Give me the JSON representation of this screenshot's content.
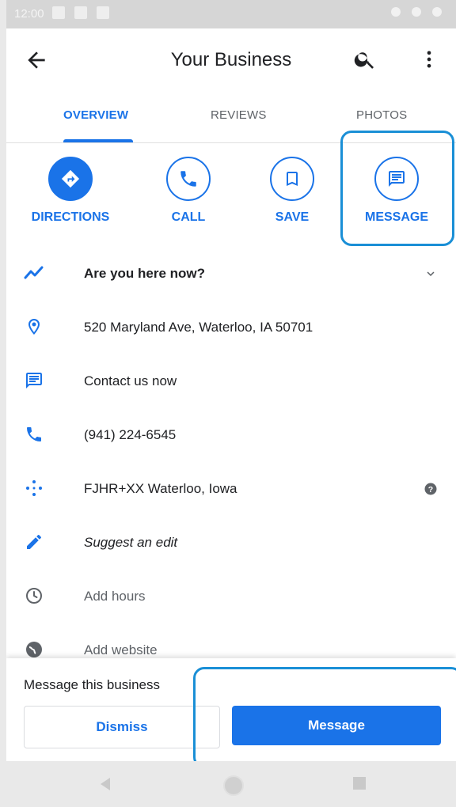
{
  "status_bar": {
    "time": "12:00"
  },
  "app_bar": {
    "title": "Your Business"
  },
  "tabs": [
    {
      "label": "OVERVIEW",
      "active": true
    },
    {
      "label": "REVIEWS",
      "active": false
    },
    {
      "label": "PHOTOS",
      "active": false
    }
  ],
  "actions": [
    {
      "label": "DIRECTIONS",
      "icon": "directions-icon"
    },
    {
      "label": "CALL",
      "icon": "phone-icon"
    },
    {
      "label": "SAVE",
      "icon": "bookmark-icon"
    },
    {
      "label": "MESSAGE",
      "icon": "message-icon"
    }
  ],
  "info_rows": [
    {
      "icon": "trend-icon",
      "text": "Are you here now?"
    },
    {
      "icon": "location-pin-icon",
      "text": "520 Maryland Ave, Waterloo, IA 50701"
    },
    {
      "icon": "message-icon",
      "text": "Contact us now"
    },
    {
      "icon": "phone-icon",
      "text": "(941) 224-6545"
    },
    {
      "icon": "plus-code-icon",
      "text": "FJHR+XX Waterloo, Iowa"
    },
    {
      "icon": "pencil-icon",
      "text": "Suggest an edit"
    },
    {
      "icon": "clock-icon",
      "text": "Add hours"
    },
    {
      "icon": "globe-icon",
      "text": "Add website"
    }
  ],
  "bottom_sheet": {
    "title": "Message this business",
    "dismiss_label": "Dismiss",
    "message_label": "Message"
  },
  "colors": {
    "accent": "#1a73e8",
    "highlight": "#1a8fd6",
    "text": "#202124",
    "muted": "#5f6368"
  }
}
